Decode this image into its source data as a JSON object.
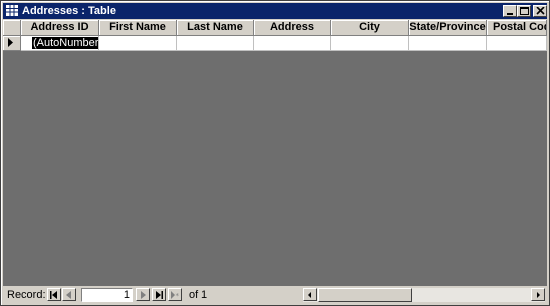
{
  "window": {
    "title": "Addresses : Table",
    "title_bar_color": "#0a246a",
    "title_text_color": "#ffffff"
  },
  "table": {
    "columns": [
      "Address ID",
      "First Name",
      "Last Name",
      "Address",
      "City",
      "State/Province",
      "Postal Cod"
    ],
    "new_row": {
      "address_id": "(AutoNumber)",
      "first_name": "",
      "last_name": "",
      "address": "",
      "city": "",
      "state_province": "",
      "postal_code": ""
    },
    "background_color": "#6e6e6e"
  },
  "navigation": {
    "record_label": "Record:",
    "current_record": "1",
    "of_label": "of",
    "total_records": "1"
  },
  "icons": {
    "table": "table-icon",
    "minimize": "minimize-icon",
    "maximize": "maximize-icon",
    "close": "close-icon",
    "row_pointer": "triangle-right-icon",
    "first": "first-record-icon",
    "previous": "previous-record-icon",
    "next": "next-record-icon",
    "last": "last-record-icon",
    "new": "new-record-icon",
    "scroll_left": "scroll-left-icon",
    "scroll_right": "scroll-right-icon"
  }
}
